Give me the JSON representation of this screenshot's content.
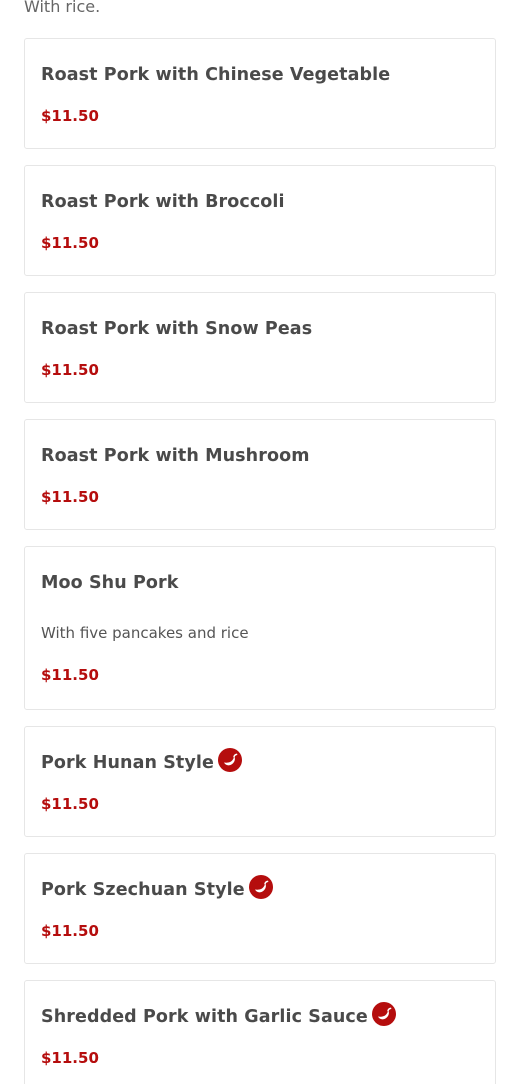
{
  "section_note": "With rice.",
  "accent_color": "#b50d0d",
  "spicy_icon": "chili-pepper-icon",
  "items": [
    {
      "title": "Roast Pork with Chinese Vegetable",
      "price": "$11.50"
    },
    {
      "title": "Roast Pork with Broccoli",
      "price": "$11.50"
    },
    {
      "title": "Roast Pork with Snow Peas",
      "price": "$11.50"
    },
    {
      "title": "Roast Pork with Mushroom",
      "price": "$11.50"
    },
    {
      "title": "Moo Shu Pork",
      "description": "With five pancakes and rice",
      "price": "$11.50"
    },
    {
      "title": "Pork Hunan Style",
      "spicy": true,
      "price": "$11.50"
    },
    {
      "title": "Pork Szechuan Style",
      "spicy": true,
      "price": "$11.50"
    },
    {
      "title": "Shredded Pork with Garlic Sauce",
      "spicy": true,
      "price": "$11.50"
    }
  ]
}
